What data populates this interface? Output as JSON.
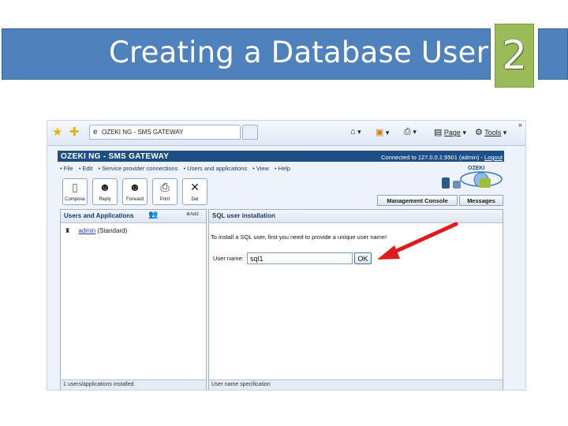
{
  "slide": {
    "title": "Creating a Database User",
    "number": "2",
    "colors": {
      "title_bar": "#4f81bd",
      "number_box": "#9bbb59",
      "arrow": "#e01b1b"
    }
  },
  "browser": {
    "tab_title": "OZEKI NG - SMS GATEWAY",
    "commands": {
      "page": "Page",
      "tools": "Tools"
    },
    "icons": [
      "favorites-star-icon",
      "add-favorites-icon",
      "ie-logo-icon",
      "home-icon",
      "rss-feed-icon",
      "print-icon",
      "page-icon",
      "tools-icon"
    ]
  },
  "app": {
    "title": "OZEKI NG - SMS GATEWAY",
    "connection_text": "Connected to 127.0.0.1:9501 (admin) - ",
    "logout_label": "Logout",
    "menu": [
      "File",
      "Edit",
      "Service provider connections",
      "Users and applications",
      "View",
      "Help"
    ],
    "logo_text": "OZEKI",
    "toolbar": [
      {
        "label": "Compose",
        "icon": "compose-icon"
      },
      {
        "label": "Reply",
        "icon": "reply-icon"
      },
      {
        "label": "Forward",
        "icon": "forward-icon"
      },
      {
        "label": "Print",
        "icon": "print-icon"
      },
      {
        "label": "Del",
        "icon": "delete-icon"
      }
    ],
    "tabs": [
      "Management Console",
      "Messages"
    ],
    "left_panel": {
      "title": "Users and Applications",
      "add_label": "Add",
      "users": [
        {
          "name": "admin",
          "type": "(Standard)"
        }
      ],
      "status": "1 users/applications installed."
    },
    "right_panel": {
      "title": "SQL user installation",
      "instruction": "To install a SQL user, first you need to provide a unique user name!",
      "username_label": "User name:",
      "username_value": "sql1",
      "ok_label": "OK",
      "status": "User name specification"
    }
  }
}
